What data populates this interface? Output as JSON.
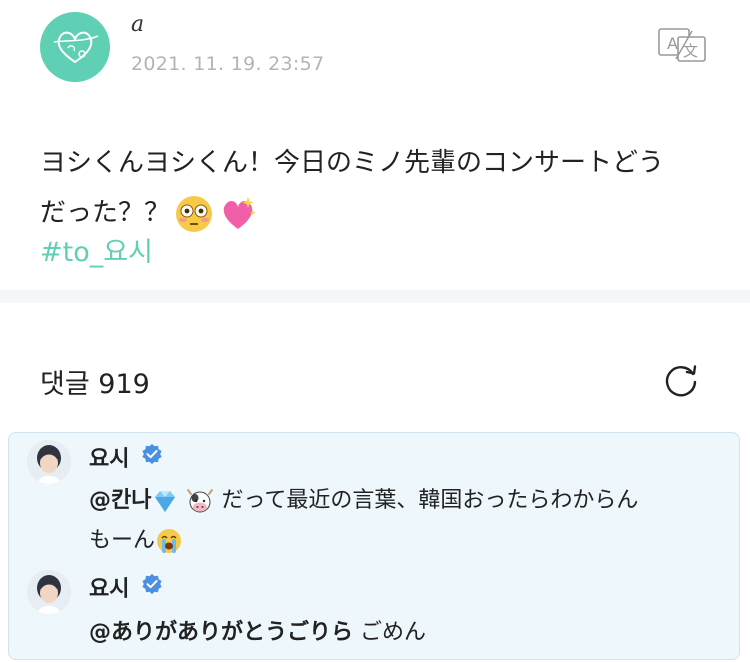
{
  "post": {
    "author_name": "a",
    "timestamp": "2021. 11. 19. 23:57",
    "text_line1": "ヨシくんヨシくん！今日のミノ先輩のコンサートどう",
    "text_line2": "だった？？",
    "emojis": [
      "flushed-face",
      "sparkling-heart"
    ],
    "hashtag": "#to_요시",
    "accent_color": "#5fd0b3"
  },
  "comments": {
    "title": "댓글 919",
    "panel_color": "#edf7fc",
    "items": [
      {
        "author": "요시",
        "verified": true,
        "mention": "@칸나",
        "mention_emojis": [
          "gem-stone",
          "cow-face"
        ],
        "text_line1": "だって最近の言葉、韓国おったらわからん",
        "text_line2": "もーん",
        "trailing_emoji": "loudly-crying-face"
      },
      {
        "author": "요시",
        "verified": true,
        "mention": "@ありがありがとうごりら",
        "text_line1": "ごめん"
      }
    ]
  }
}
